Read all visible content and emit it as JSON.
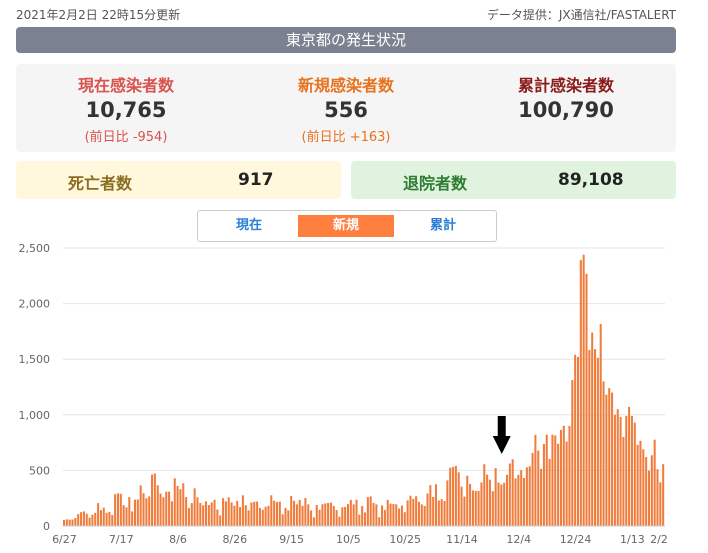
{
  "header": {
    "updated": "2021年2月2日 22時15分更新",
    "source": "データ提供：JX通信社/FASTALERT",
    "title": "東京都の発生状況"
  },
  "stats": {
    "current": {
      "label": "現在感染者数",
      "value": "10,765",
      "diff": "(前日比 -954)"
    },
    "new": {
      "label": "新規感染者数",
      "value": "556",
      "diff": "(前日比 +163)"
    },
    "total": {
      "label": "累計感染者数",
      "value": "100,790"
    }
  },
  "deaths": {
    "label": "死亡者数",
    "value": "917"
  },
  "discharged": {
    "label": "退院者数",
    "value": "89,108"
  },
  "tabs": [
    "現在",
    "新規",
    "累計"
  ],
  "active_tab": 1,
  "colors": {
    "bar": "#f07c3c",
    "active_tab": "#ff7f3f",
    "current": "#d9534f",
    "new": "#e8731f",
    "total": "#8b1a1a",
    "deaths_bg": "#fff8dc",
    "discharged_bg": "#dff3df"
  },
  "chart_data": {
    "type": "bar",
    "ylim": [
      0,
      2500
    ],
    "y_ticks": [
      "0",
      "500",
      "1,000",
      "1,500",
      "2,000",
      "2,500"
    ],
    "x_ticks": [
      "6/27",
      "7/17",
      "8/6",
      "8/26",
      "9/15",
      "10/5",
      "10/25",
      "11/14",
      "12/4",
      "12/24",
      "1/13",
      "2/2"
    ],
    "start_date": "2020-06-27",
    "grid": true,
    "annotation": "arrow marker near 11/28",
    "values": [
      55,
      60,
      57,
      58,
      72,
      107,
      124,
      131,
      111,
      75,
      102,
      119,
      206,
      143,
      165,
      119,
      127,
      99,
      286,
      293,
      290,
      188,
      168,
      260,
      131,
      237,
      238,
      366,
      295,
      250,
      266,
      463,
      472,
      367,
      292,
      258,
      309,
      309,
      222,
      429,
      360,
      331,
      385,
      260,
      161,
      206,
      339,
      258,
      207,
      186,
      222,
      188,
      212,
      236,
      148,
      95,
      250,
      222,
      258,
      212,
      182,
      226,
      170,
      276,
      187,
      141,
      211,
      218,
      220,
      163,
      146,
      173,
      181,
      276,
      228,
      216,
      219,
      105,
      163,
      141,
      270,
      226,
      195,
      235,
      182,
      252,
      195,
      140,
      78,
      189,
      146,
      196,
      203,
      207,
      211,
      179,
      143,
      84,
      168,
      172,
      197,
      235,
      194,
      237,
      102,
      179,
      122,
      260,
      266,
      208,
      194,
      79,
      185,
      143,
      235,
      201,
      198,
      195,
      158,
      184,
      124,
      230,
      272,
      244,
      268,
      218,
      194,
      180,
      292,
      367,
      261,
      375,
      230,
      241,
      225,
      410,
      524,
      531,
      540,
      483,
      354,
      264,
      452,
      378,
      320,
      316,
      316,
      392,
      556,
      462,
      416,
      313,
      522,
      391,
      373,
      389,
      460,
      562,
      600,
      428,
      460,
      502,
      432,
      528,
      538,
      657,
      820,
      678,
      514,
      738,
      822,
      603,
      821,
      814,
      740,
      864,
      901,
      759,
      900,
      1313,
      1540,
      1520,
      2393,
      2440,
      2267,
      1584,
      1740,
      1590,
      1513,
      1816,
      1300,
      1180,
      1240,
      1200,
      1000,
      1050,
      980,
      800,
      990,
      1071,
      990,
      930,
      730,
      767,
      690,
      620,
      498,
      636,
      776,
      510,
      393,
      556
    ]
  }
}
